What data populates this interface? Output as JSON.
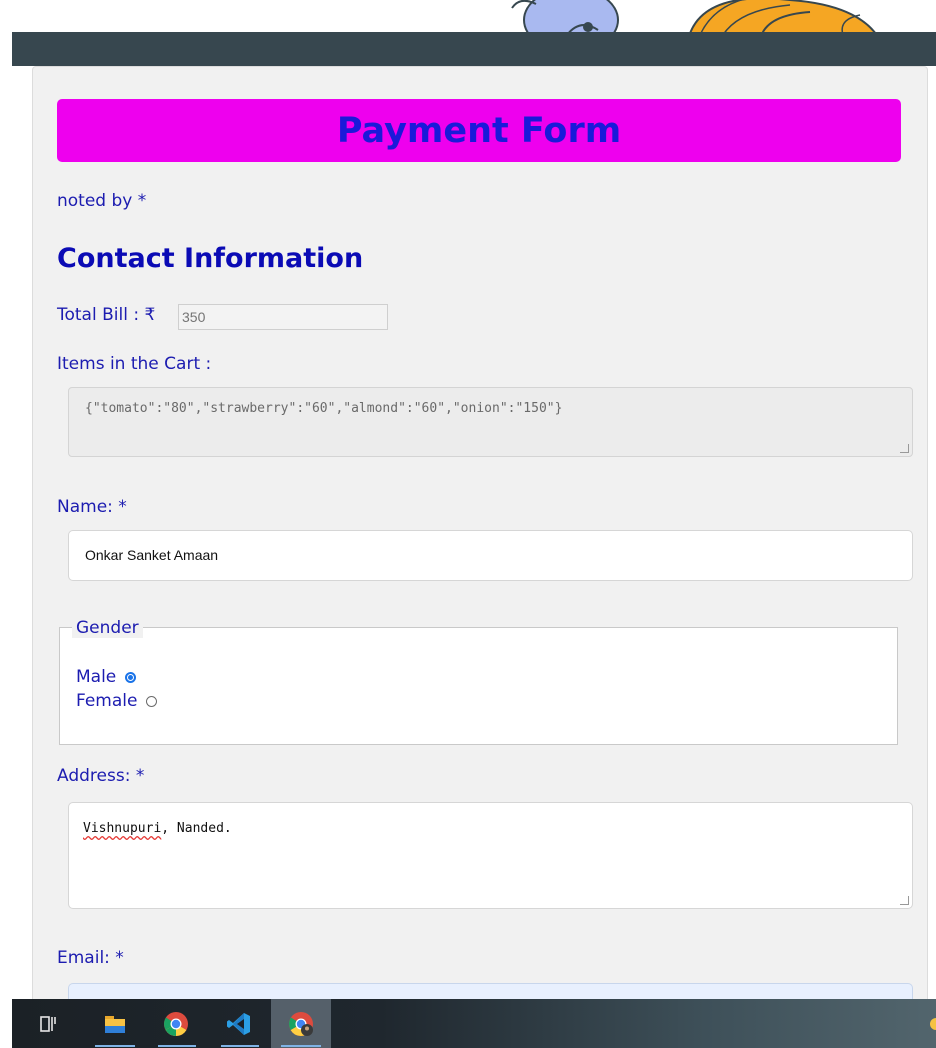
{
  "form": {
    "title": "Payment Form",
    "note": "noted by *",
    "section_heading": "Contact Information",
    "total_bill_label": "Total Bill : ₹",
    "total_bill_value": "350",
    "cart_label": "Items in the Cart :",
    "cart_value": "{\"tomato\":\"80\",\"strawberry\":\"60\",\"almond\":\"60\",\"onion\":\"150\"}",
    "name_label": "Name: *",
    "name_value": "Onkar Sanket Amaan",
    "gender_legend": "Gender",
    "gender_options": [
      {
        "label": "Male",
        "checked": true
      },
      {
        "label": "Female",
        "checked": false
      }
    ],
    "address_label": "Address: *",
    "address_value_word": "Vishnupuri",
    "address_value_rest": ", Nanded.",
    "email_label": "Email: *",
    "email_value": ""
  },
  "taskbar": {
    "icons": [
      "task-view-icon",
      "file-explorer-icon",
      "chrome-icon",
      "vscode-icon",
      "chrome-profile-icon"
    ]
  },
  "colors": {
    "banner": "#ee00ee",
    "title_text": "#1a1ad9",
    "label_text": "#1c1cb0",
    "topbar": "#37474f",
    "panel": "#f1f1f1",
    "radio_accent": "#1a73e8"
  }
}
